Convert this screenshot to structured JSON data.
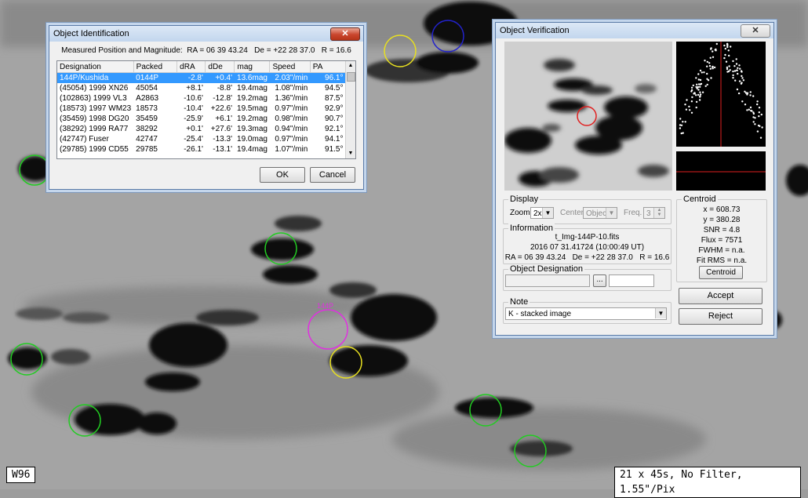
{
  "id_window": {
    "title": "Object Identification",
    "close_label": "✕",
    "summary": "Measured Position and Magnitude:  RA = 06 39 43.24   De = +22 28 37.0   R = 16.6",
    "columns": [
      "Designation",
      "Packed",
      "dRA",
      "dDe",
      "mag",
      "Speed",
      "PA"
    ],
    "rows": [
      [
        "144P/Kushida",
        "0144P",
        "-2.8'",
        "+0.4'",
        "13.6mag",
        "2.03\"/min",
        "96.1°"
      ],
      [
        "(45054) 1999 XN26",
        "45054",
        "+8.1'",
        "-8.8'",
        "19.4mag",
        "1.08\"/min",
        "94.5°"
      ],
      [
        "(102863) 1999 VL3",
        "A2863",
        "-10.6'",
        "-12.8'",
        "19.2mag",
        "1.36\"/min",
        "87.5°"
      ],
      [
        "(18573) 1997 WM23",
        "18573",
        "-10.4'",
        "+22.6'",
        "19.5mag",
        "0.97\"/min",
        "92.9°"
      ],
      [
        "(35459) 1998 DG20",
        "35459",
        "-25.9'",
        "+6.1'",
        "19.2mag",
        "0.98\"/min",
        "90.7°"
      ],
      [
        "(38292) 1999 RA77",
        "38292",
        "+0.1'",
        "+27.6'",
        "19.3mag",
        "0.94\"/min",
        "92.1°"
      ],
      [
        "(42747) Fuser",
        "42747",
        "-25.4'",
        "-13.3'",
        "19.0mag",
        "0.97\"/min",
        "94.1°"
      ],
      [
        "(29785) 1999 CD55",
        "29785",
        "-26.1'",
        "-13.1'",
        "19.4mag",
        "1.07\"/min",
        "91.5°"
      ]
    ],
    "ok_label": "OK",
    "cancel_label": "Cancel"
  },
  "verify_window": {
    "title": "Object Verification",
    "close_label": "✕",
    "display": {
      "caption": "Display",
      "zoom_label": "Zoom",
      "zoom_value": "2x",
      "center_label": "Center",
      "center_value": "Object",
      "freq_label": "Freq.",
      "freq_value": "3"
    },
    "centroid": {
      "caption": "Centroid",
      "x": "x = 608.73",
      "y": "y = 380.28",
      "snr": "SNR = 4.8",
      "flux": "Flux = 7571",
      "fwhm": "FWHM = n.a.",
      "fitrms": "Fit RMS = n.a.",
      "button": "Centroid"
    },
    "information": {
      "caption": "Information",
      "file": "t_Img-144P-10.fits",
      "date": "2016 07 31.41724 (10:00:49 UT)",
      "coords": "RA = 06 39 43.24   De = +22 28 37.0   R = 16.6"
    },
    "designation": {
      "caption": "Object Designation",
      "browse": "...",
      "value": "",
      "code": ""
    },
    "note": {
      "caption": "Note",
      "value": "K - stacked image"
    },
    "accept_label": "Accept",
    "reject_label": "Reject"
  },
  "overlay": {
    "label_144p": "144P"
  },
  "stamps": {
    "observatory": "W96",
    "exposure": "21 x 45s, No Filter, 1.55\"/Pix"
  }
}
